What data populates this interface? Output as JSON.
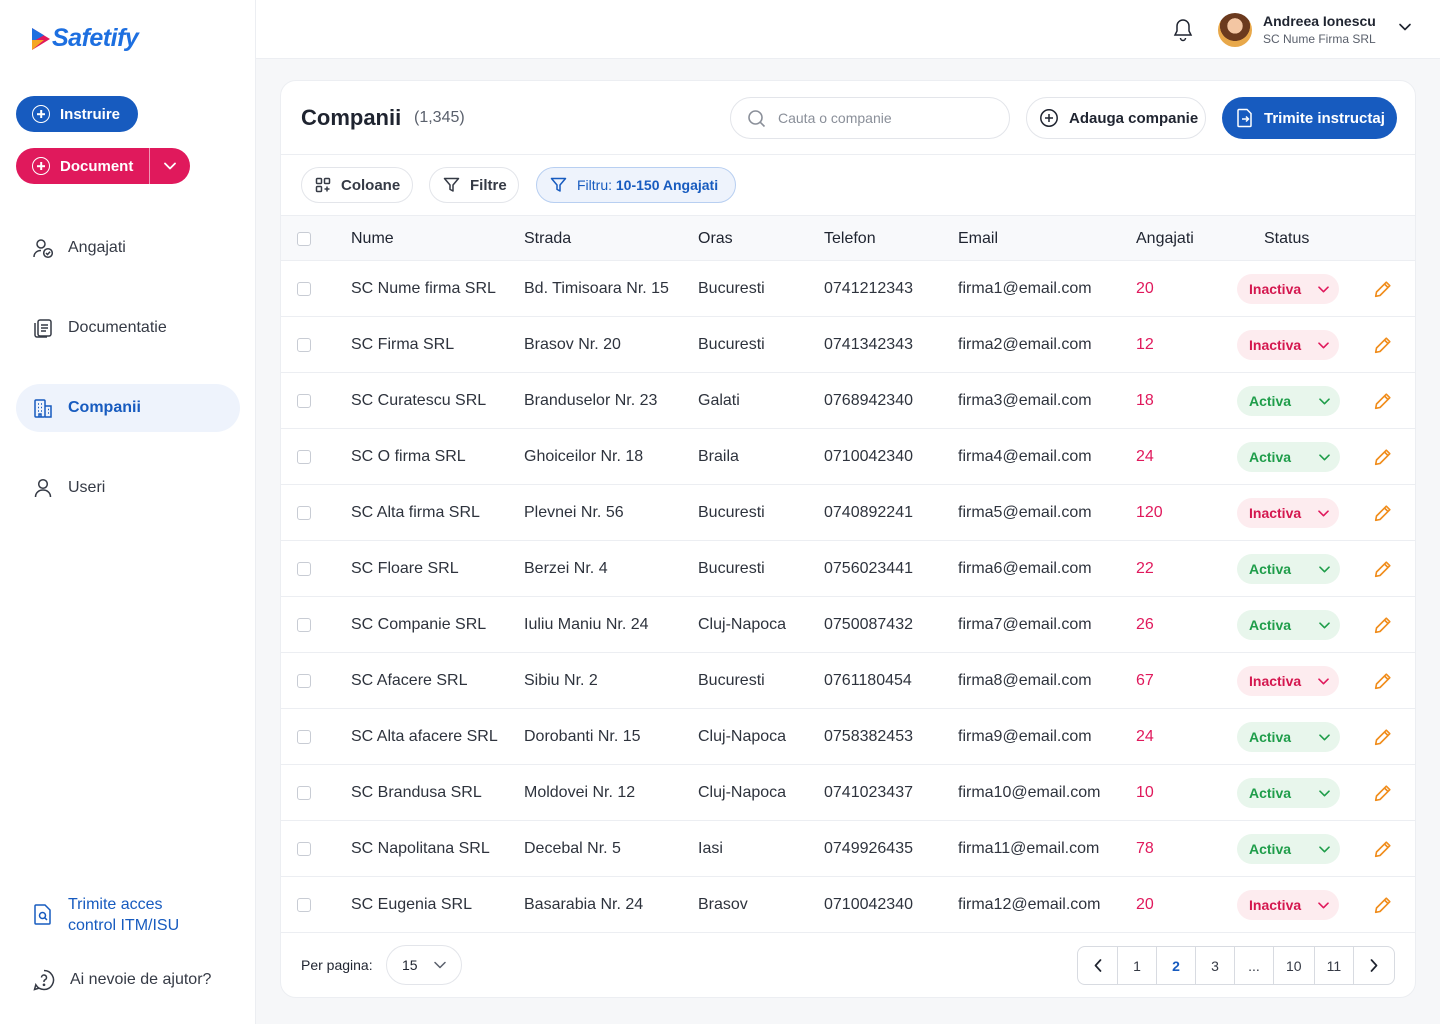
{
  "brand": {
    "name": "Safetify"
  },
  "sidebar": {
    "instruire_label": "Instruire",
    "document_label": "Document",
    "items": [
      {
        "label": "Angajati",
        "icon": "user-check-icon",
        "active": false
      },
      {
        "label": "Documentatie",
        "icon": "documents-icon",
        "active": false
      },
      {
        "label": "Companii",
        "icon": "building-icon",
        "active": true
      },
      {
        "label": "Useri",
        "icon": "user-icon",
        "active": false
      }
    ],
    "access_link_line1": "Trimite acces",
    "access_link_line2": "control ITM/ISU",
    "help_label": "Ai nevoie de ajutor?"
  },
  "header": {
    "user_name": "Andreea Ionescu",
    "user_org": "SC Nume Firma SRL"
  },
  "page": {
    "title": "Companii",
    "count": "(1,345)",
    "search_placeholder": "Cauta o companie",
    "add_label": "Adauga companie",
    "send_label": "Trimite instructaj",
    "chip_columns": "Coloane",
    "chip_filters": "Filtre",
    "chip_filter_prefix": "Filtru:",
    "chip_filter_value": "10-150 Angajati"
  },
  "table": {
    "columns": [
      "Nume",
      "Strada",
      "Oras",
      "Telefon",
      "Email",
      "Angajati",
      "Status"
    ],
    "rows": [
      {
        "nume": "SC Nume firma SRL",
        "strada": "Bd. Timisoara Nr. 15",
        "oras": "Bucuresti",
        "telefon": "0741212343",
        "email": "firma1@email.com",
        "angajati": "20",
        "status": "Inactiva",
        "state": "inactive"
      },
      {
        "nume": "SC Firma SRL",
        "strada": "Brasov Nr. 20",
        "oras": "Bucuresti",
        "telefon": "0741342343",
        "email": "firma2@email.com",
        "angajati": "12",
        "status": "Inactiva",
        "state": "inactive"
      },
      {
        "nume": "SC Curatescu SRL",
        "strada": "Branduselor Nr. 23",
        "oras": "Galati",
        "telefon": "0768942340",
        "email": "firma3@email.com",
        "angajati": "18",
        "status": "Activa",
        "state": "active"
      },
      {
        "nume": "SC O firma SRL",
        "strada": "Ghoiceilor Nr. 18",
        "oras": "Braila",
        "telefon": "0710042340",
        "email": "firma4@email.com",
        "angajati": "24",
        "status": "Activa",
        "state": "active"
      },
      {
        "nume": "SC Alta firma SRL",
        "strada": "Plevnei Nr. 56",
        "oras": "Bucuresti",
        "telefon": "0740892241",
        "email": "firma5@email.com",
        "angajati": "120",
        "status": "Inactiva",
        "state": "inactive"
      },
      {
        "nume": "SC Floare SRL",
        "strada": "Berzei Nr. 4",
        "oras": "Bucuresti",
        "telefon": "0756023441",
        "email": "firma6@email.com",
        "angajati": "22",
        "status": "Activa",
        "state": "active"
      },
      {
        "nume": "SC Companie SRL",
        "strada": "Iuliu Maniu Nr. 24",
        "oras": "Cluj-Napoca",
        "telefon": "0750087432",
        "email": "firma7@email.com",
        "angajati": "26",
        "status": "Activa",
        "state": "active"
      },
      {
        "nume": "SC Afacere SRL",
        "strada": "Sibiu Nr. 2",
        "oras": "Bucuresti",
        "telefon": "0761180454",
        "email": "firma8@email.com",
        "angajati": "67",
        "status": "Inactiva",
        "state": "inactive"
      },
      {
        "nume": "SC Alta afacere SRL",
        "strada": "Dorobanti Nr. 15",
        "oras": "Cluj-Napoca",
        "telefon": "0758382453",
        "email": "firma9@email.com",
        "angajati": "24",
        "status": "Activa",
        "state": "active"
      },
      {
        "nume": "SC Brandusa SRL",
        "strada": "Moldovei Nr. 12",
        "oras": "Cluj-Napoca",
        "telefon": "0741023437",
        "email": "firma10@email.com",
        "angajati": "10",
        "status": "Activa",
        "state": "active"
      },
      {
        "nume": "SC Napolitana SRL",
        "strada": "Decebal Nr. 5",
        "oras": "Iasi",
        "telefon": "0749926435",
        "email": "firma11@email.com",
        "angajati": "78",
        "status": "Activa",
        "state": "active"
      },
      {
        "nume": "SC Eugenia SRL",
        "strada": "Basarabia Nr. 24",
        "oras": "Brasov",
        "telefon": "0710042340",
        "email": "firma12@email.com",
        "angajati": "20",
        "status": "Inactiva",
        "state": "inactive"
      }
    ]
  },
  "footer": {
    "per_page_label": "Per pagina:",
    "per_page_value": "15",
    "pages": [
      "1",
      "2",
      "3",
      "...",
      "10",
      "11"
    ],
    "current_page": "2"
  },
  "colors": {
    "primary": "#175bbf",
    "accent": "#e0195c",
    "active": "#1f9d4a",
    "edit": "#f08c1a"
  }
}
